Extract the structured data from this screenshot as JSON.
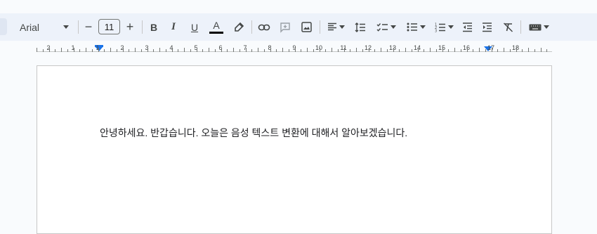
{
  "toolbar": {
    "font_family": "Arial",
    "font_size": "11",
    "decrease_size_label": "−",
    "increase_size_label": "+",
    "bold_label": "B",
    "italic_label": "I",
    "underline_label": "U",
    "text_color_label": "A",
    "text_color": "#000000",
    "accent_color": "#1a73e8"
  },
  "ruler": {
    "labels": [
      "2",
      "1",
      "1",
      "2",
      "3",
      "4",
      "5",
      "6",
      "7",
      "8",
      "9",
      "10",
      "11",
      "12",
      "13",
      "14",
      "15",
      "16",
      "17",
      "18"
    ]
  },
  "document": {
    "body_text": "안녕하세요. 반갑습니다. 오늘은 음성 텍스트 변환에 대해서 알아보겠습니다."
  }
}
